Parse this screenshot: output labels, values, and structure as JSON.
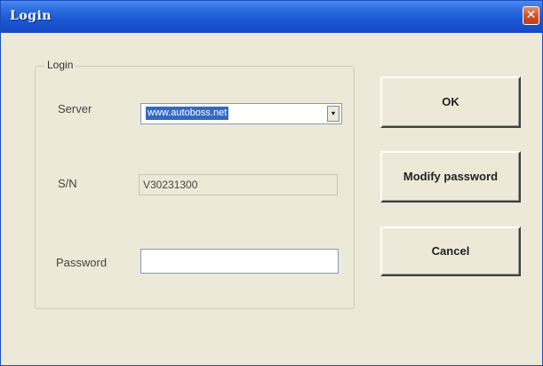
{
  "window": {
    "title": "Login",
    "close_glyph": "✕"
  },
  "group": {
    "label": "Login"
  },
  "fields": {
    "server_label": "Server",
    "server_value": "www.autoboss.net",
    "server_dropdown_glyph": "▾",
    "sn_label": "S/N",
    "sn_value": "V30231300",
    "password_label": "Password",
    "password_value": ""
  },
  "buttons": {
    "ok": "OK",
    "modify_password": "Modify password",
    "cancel": "Cancel"
  },
  "icons": {
    "close": "close-icon",
    "dropdown": "chevron-down-icon"
  },
  "colors": {
    "titlebar": "#1b57d3",
    "close_button": "#d4512f",
    "window_background": "#ece9d8",
    "selection": "#316ac5"
  }
}
